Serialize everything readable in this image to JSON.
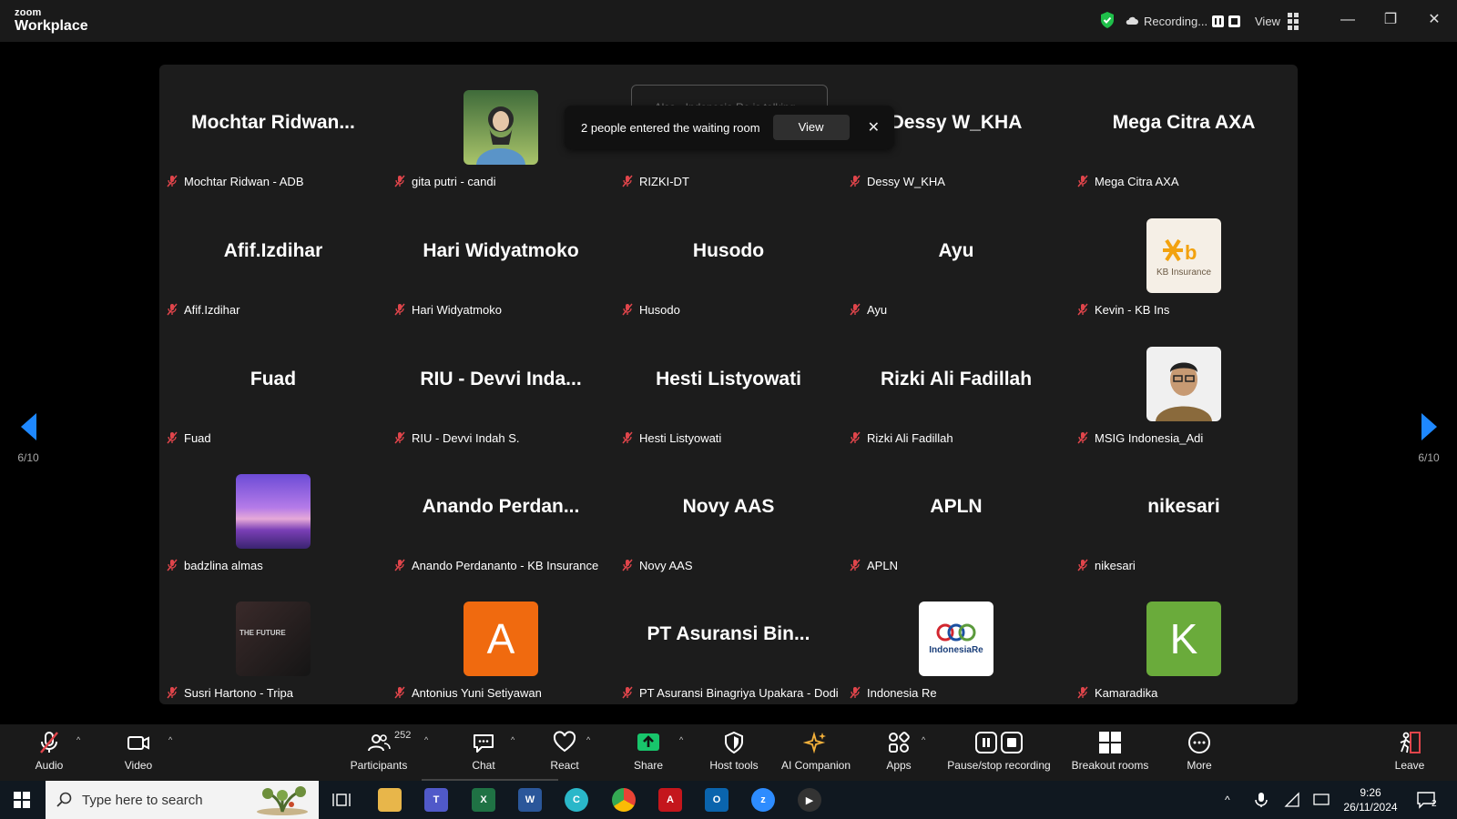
{
  "app": {
    "brand_top": "zoom",
    "brand_bottom": "Workplace"
  },
  "titlebar": {
    "recording_label": "Recording...",
    "view_label": "View"
  },
  "notification": {
    "ghost_text": "Alsa - Indonesia Re is talking...",
    "message": "2 people entered the waiting room",
    "view_label": "View",
    "close_glyph": "✕"
  },
  "pager": {
    "left_label": "6/10",
    "right_label": "6/10"
  },
  "participants": [
    {
      "display": "Mochtar  Ridwan...",
      "name": "Mochtar Ridwan - ADB",
      "avatar": "none"
    },
    {
      "display": "",
      "name": "gita putri - candi",
      "avatar": "photo-woman"
    },
    {
      "display": "RIZKI-DT",
      "name": "RIZKI-DT",
      "avatar": "none"
    },
    {
      "display": "Dessy W_KHA",
      "name": "Dessy W_KHA",
      "avatar": "none"
    },
    {
      "display": "Mega Citra AXA",
      "name": "Mega Citra AXA",
      "avatar": "none"
    },
    {
      "display": "Afif.Izdihar",
      "name": "Afif.Izdihar",
      "avatar": "none"
    },
    {
      "display": "Hari Widyatmoko",
      "name": "Hari Widyatmoko",
      "avatar": "none"
    },
    {
      "display": "Husodo",
      "name": "Husodo",
      "avatar": "none"
    },
    {
      "display": "Ayu",
      "name": "Ayu",
      "avatar": "none"
    },
    {
      "display": "",
      "name": "Kevin - KB Ins",
      "avatar": "kb-logo",
      "logo_text": "KB Insurance"
    },
    {
      "display": "Fuad",
      "name": "Fuad",
      "avatar": "none"
    },
    {
      "display": "RIU - Devvi Inda...",
      "name": "RIU - Devvi Indah S.",
      "avatar": "none"
    },
    {
      "display": "Hesti Listyowati",
      "name": "Hesti Listyowati",
      "avatar": "none"
    },
    {
      "display": "Rizki Ali Fadillah",
      "name": "Rizki Ali Fadillah",
      "avatar": "none"
    },
    {
      "display": "",
      "name": "MSIG Indonesia_Adi",
      "avatar": "photo-man"
    },
    {
      "display": "",
      "name": "badzlina almas",
      "avatar": "photo-sunset"
    },
    {
      "display": "Anando  Perdan...",
      "name": "Anando Perdananto - KB Insurance",
      "avatar": "none"
    },
    {
      "display": "Novy AAS",
      "name": "Novy AAS",
      "avatar": "none"
    },
    {
      "display": "APLN",
      "name": "APLN",
      "avatar": "none"
    },
    {
      "display": "nikesari",
      "name": "nikesari",
      "avatar": "none"
    },
    {
      "display": "",
      "name": "Susri Hartono - Tripa",
      "avatar": "photo-slide",
      "logo_text": "THE FUTURE"
    },
    {
      "display": "",
      "name": "Antonius Yuni Setiyawan",
      "avatar": "letter",
      "letter": "A",
      "color": "#f06a0f"
    },
    {
      "display": "PT  Asuransi  Bin...",
      "name": "PT Asuransi Binagriya Upakara - Dodi",
      "avatar": "none"
    },
    {
      "display": "",
      "name": "Indonesia Re",
      "avatar": "indore-logo",
      "logo_text": "IndonesiaRe"
    },
    {
      "display": "",
      "name": "Kamaradika",
      "avatar": "letter",
      "letter": "K",
      "color": "#6aab3b"
    }
  ],
  "toolbar": {
    "audio": "Audio",
    "video": "Video",
    "participants": "Participants",
    "participants_count": "252",
    "chat": "Chat",
    "react": "React",
    "share": "Share",
    "host_tools": "Host tools",
    "ai_companion": "AI Companion",
    "apps": "Apps",
    "pause_stop": "Pause/stop recording",
    "breakout": "Breakout rooms",
    "more": "More",
    "leave": "Leave"
  },
  "taskbar": {
    "search_placeholder": "Type here to search",
    "time": "9:26",
    "date": "26/11/2024",
    "notif_count": "2"
  },
  "colors": {
    "accent": "#1e88ff",
    "share_green": "#18c56b",
    "mic_off_red": "#e0454b"
  }
}
